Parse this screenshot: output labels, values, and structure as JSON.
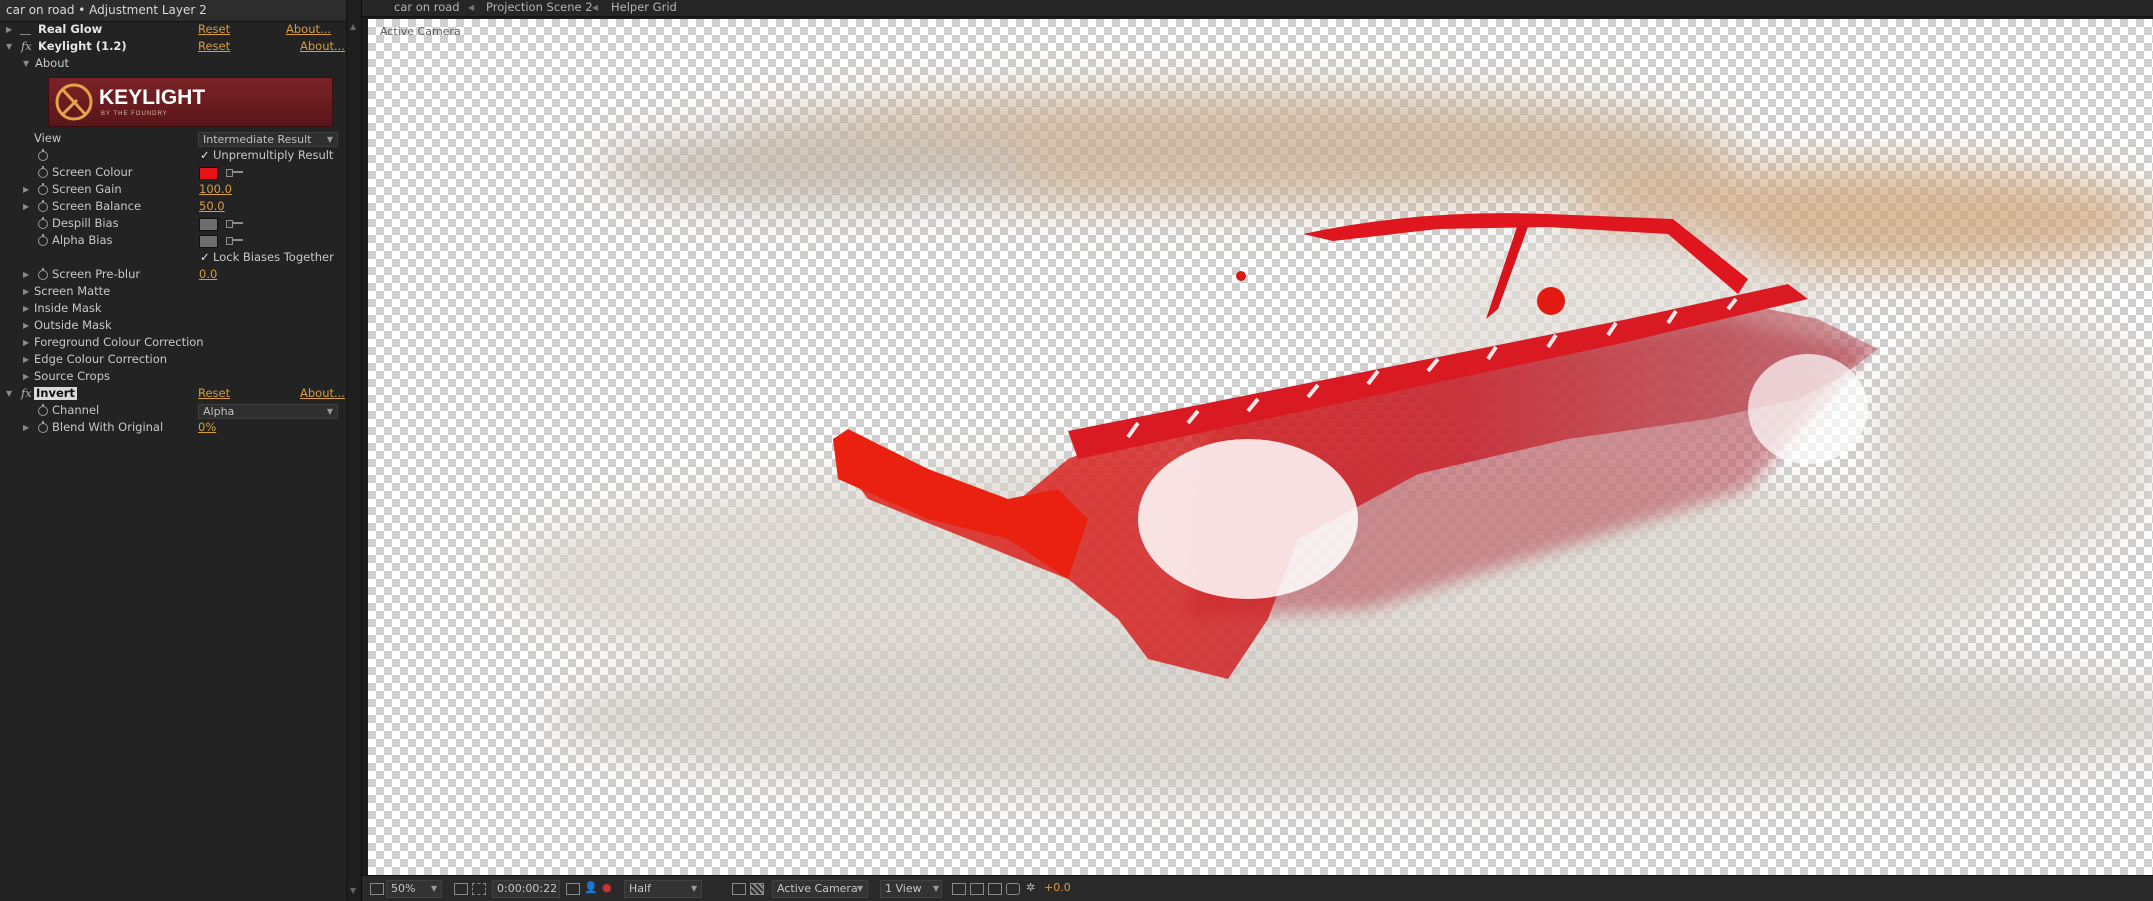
{
  "effect_controls": {
    "header": "car on road • Adjustment Layer 2",
    "real_glow": {
      "name": "Real Glow",
      "reset": "Reset",
      "about": "About..."
    },
    "keylight": {
      "fx": "fx",
      "name": "Keylight (1.2)",
      "reset": "Reset",
      "about": "About...",
      "about_section": "About",
      "logo_text": "KEYLIGHT",
      "logo_sub": "BY THE FOUNDRY",
      "view_label": "View",
      "view_value": "Intermediate Result",
      "unpremultiply_label": "Unpremultiply Result",
      "screen_colour_label": "Screen Colour",
      "screen_colour": "#e8131a",
      "screen_gain_label": "Screen Gain",
      "screen_gain_value": "100.0",
      "screen_balance_label": "Screen Balance",
      "screen_balance_value": "50.0",
      "despill_bias_label": "Despill Bias",
      "alpha_bias_label": "Alpha Bias",
      "lock_biases_label": "Lock Biases Together",
      "screen_preblur_label": "Screen Pre-blur",
      "screen_preblur_value": "0.0",
      "groups": [
        "Screen Matte",
        "Inside Mask",
        "Outside Mask",
        "Foreground Colour Correction",
        "Edge Colour Correction",
        "Source Crops"
      ]
    },
    "invert": {
      "fx": "fx",
      "name": "Invert",
      "reset": "Reset",
      "about": "About...",
      "channel_label": "Channel",
      "channel_value": "Alpha",
      "blend_label": "Blend With Original",
      "blend_value": "0%"
    }
  },
  "viewer": {
    "tabs": [
      "car on road",
      "Projection Scene 2",
      "Helper Grid"
    ],
    "overlay_label": "Active Camera",
    "bottom": {
      "zoom": "50%",
      "timecode": "0:00:00:22",
      "resolution": "Half",
      "camera": "Active Camera",
      "views": "1 View",
      "exposure": "+0.0"
    }
  }
}
